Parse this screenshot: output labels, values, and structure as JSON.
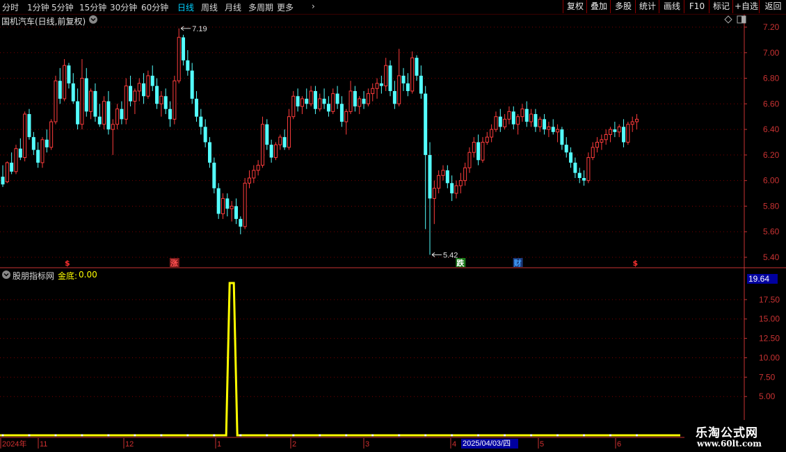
{
  "toolbar": {
    "periods": [
      "分时",
      "1分钟",
      "5分钟",
      "15分钟",
      "30分钟",
      "60分钟",
      "日线",
      "周线",
      "月线",
      "多周期",
      "更多"
    ],
    "active_period": "日线",
    "more_arrow": "›",
    "buttons": [
      "复权",
      "叠加",
      "多股",
      "统计",
      "画线",
      "F10",
      "标记",
      "+自选",
      "返回"
    ]
  },
  "main_panel": {
    "title": "国机汽车(日线,前复权)",
    "high_label": "7.19",
    "low_label": "5.42",
    "markers": [
      {
        "text": "$",
        "color": "#ff3030"
      },
      {
        "text": "涨",
        "color": "#ff5050"
      },
      {
        "text": "跌",
        "color": "#ffffff"
      },
      {
        "text": "财",
        "color": "#40a0ff"
      },
      {
        "text": "$",
        "color": "#ff3030"
      }
    ]
  },
  "sub_panel": {
    "indicator_name": "股朋指标网",
    "series_label": "金底:",
    "series_value": "0.00",
    "current_value_box": "19.64"
  },
  "x_axis": {
    "labels": [
      "2024年",
      "11",
      "12",
      "1",
      "2",
      "3",
      "4",
      "5",
      "6"
    ],
    "cursor_date": "2025/04/03/四"
  },
  "watermark": {
    "line1": "乐淘公式网",
    "line2": "www.60lt.com"
  },
  "colors": {
    "up": "#ff3c3c",
    "down": "#54ffff",
    "indicator": "#ffff00",
    "grid": "#7a0000",
    "axis": "#c83232"
  },
  "chart_data": [
    {
      "type": "candlestick",
      "title": "国机汽车(日线,前复权)",
      "y_ticks": [
        7.2,
        7.0,
        6.8,
        6.6,
        6.4,
        6.2,
        6.0,
        5.8,
        5.6,
        5.4
      ],
      "ylim": [
        5.37,
        7.26
      ],
      "annotations": [
        {
          "label": "7.19",
          "value": 7.19
        },
        {
          "label": "5.42",
          "value": 5.42
        }
      ],
      "ohlc": [
        [
          6.03,
          6.12,
          5.95,
          5.97
        ],
        [
          5.99,
          6.15,
          5.98,
          6.14
        ],
        [
          6.14,
          6.22,
          6.05,
          6.07
        ],
        [
          6.07,
          6.28,
          6.05,
          6.25
        ],
        [
          6.25,
          6.33,
          6.16,
          6.18
        ],
        [
          6.18,
          6.54,
          6.15,
          6.52
        ],
        [
          6.52,
          6.56,
          6.32,
          6.34
        ],
        [
          6.34,
          6.38,
          6.2,
          6.24
        ],
        [
          6.24,
          6.3,
          6.1,
          6.14
        ],
        [
          6.14,
          6.34,
          6.1,
          6.32
        ],
        [
          6.32,
          6.4,
          6.22,
          6.26
        ],
        [
          6.26,
          6.48,
          6.24,
          6.46
        ],
        [
          6.46,
          6.82,
          6.44,
          6.78
        ],
        [
          6.78,
          6.88,
          6.6,
          6.64
        ],
        [
          6.64,
          6.95,
          6.62,
          6.9
        ],
        [
          6.9,
          6.92,
          6.72,
          6.76
        ],
        [
          6.76,
          6.84,
          6.6,
          6.62
        ],
        [
          6.62,
          6.72,
          6.4,
          6.44
        ],
        [
          6.44,
          6.95,
          6.4,
          6.8
        ],
        [
          6.8,
          6.88,
          6.5,
          6.54
        ],
        [
          6.54,
          6.72,
          6.48,
          6.7
        ],
        [
          6.7,
          6.76,
          6.46,
          6.5
        ],
        [
          6.5,
          6.6,
          6.42,
          6.44
        ],
        [
          6.44,
          6.66,
          6.4,
          6.62
        ],
        [
          6.62,
          6.7,
          6.36,
          6.4
        ],
        [
          6.4,
          6.48,
          6.2,
          6.44
        ],
        [
          6.44,
          6.6,
          6.4,
          6.56
        ],
        [
          6.56,
          6.62,
          6.44,
          6.48
        ],
        [
          6.48,
          6.8,
          6.44,
          6.74
        ],
        [
          6.74,
          6.82,
          6.58,
          6.62
        ],
        [
          6.62,
          6.72,
          6.52,
          6.7
        ],
        [
          6.7,
          6.8,
          6.62,
          6.76
        ],
        [
          6.76,
          6.84,
          6.6,
          6.66
        ],
        [
          6.66,
          6.86,
          6.64,
          6.82
        ],
        [
          6.82,
          6.9,
          6.7,
          6.74
        ],
        [
          6.74,
          6.8,
          6.56,
          6.6
        ],
        [
          6.6,
          6.7,
          6.5,
          6.66
        ],
        [
          6.66,
          6.72,
          6.52,
          6.56
        ],
        [
          6.56,
          6.62,
          6.42,
          6.48
        ],
        [
          6.48,
          6.82,
          6.44,
          6.78
        ],
        [
          6.78,
          7.19,
          6.76,
          7.12
        ],
        [
          7.12,
          7.14,
          6.9,
          6.94
        ],
        [
          6.94,
          7.02,
          6.82,
          6.86
        ],
        [
          6.86,
          6.92,
          6.6,
          6.64
        ],
        [
          6.64,
          6.7,
          6.46,
          6.5
        ],
        [
          6.5,
          6.56,
          6.36,
          6.42
        ],
        [
          6.42,
          6.48,
          6.26,
          6.3
        ],
        [
          6.3,
          6.34,
          6.1,
          6.14
        ],
        [
          6.14,
          6.18,
          5.9,
          5.94
        ],
        [
          5.94,
          5.98,
          5.7,
          5.74
        ],
        [
          5.74,
          5.9,
          5.7,
          5.86
        ],
        [
          5.86,
          5.9,
          5.72,
          5.78
        ],
        [
          5.78,
          5.84,
          5.68,
          5.8
        ],
        [
          5.8,
          5.86,
          5.66,
          5.7
        ],
        [
          5.7,
          5.72,
          5.58,
          5.64
        ],
        [
          5.64,
          6.02,
          5.62,
          5.98
        ],
        [
          5.98,
          6.08,
          5.94,
          6.02
        ],
        [
          6.02,
          6.12,
          5.98,
          6.08
        ],
        [
          6.08,
          6.16,
          6.04,
          6.12
        ],
        [
          6.12,
          6.5,
          6.1,
          6.44
        ],
        [
          6.44,
          6.48,
          6.24,
          6.28
        ],
        [
          6.28,
          6.32,
          6.14,
          6.18
        ],
        [
          6.18,
          6.3,
          6.16,
          6.28
        ],
        [
          6.28,
          6.36,
          6.24,
          6.34
        ],
        [
          6.34,
          6.4,
          6.24,
          6.26
        ],
        [
          6.26,
          6.56,
          6.24,
          6.5
        ],
        [
          6.5,
          6.7,
          6.48,
          6.66
        ],
        [
          6.66,
          6.72,
          6.54,
          6.58
        ],
        [
          6.58,
          6.66,
          6.52,
          6.64
        ],
        [
          6.64,
          6.72,
          6.56,
          6.6
        ],
        [
          6.6,
          6.74,
          6.58,
          6.7
        ],
        [
          6.7,
          6.74,
          6.52,
          6.56
        ],
        [
          6.56,
          6.68,
          6.54,
          6.64
        ],
        [
          6.64,
          6.72,
          6.56,
          6.6
        ],
        [
          6.6,
          6.66,
          6.5,
          6.54
        ],
        [
          6.54,
          6.72,
          6.52,
          6.68
        ],
        [
          6.68,
          6.74,
          6.56,
          6.6
        ],
        [
          6.6,
          6.66,
          6.42,
          6.46
        ],
        [
          6.46,
          6.56,
          6.36,
          6.54
        ],
        [
          6.54,
          6.78,
          6.52,
          6.7
        ],
        [
          6.7,
          6.74,
          6.54,
          6.58
        ],
        [
          6.58,
          6.66,
          6.52,
          6.64
        ],
        [
          6.64,
          6.7,
          6.56,
          6.6
        ],
        [
          6.6,
          6.72,
          6.58,
          6.68
        ],
        [
          6.68,
          6.76,
          6.62,
          6.72
        ],
        [
          6.72,
          6.8,
          6.64,
          6.76
        ],
        [
          6.76,
          6.82,
          6.68,
          6.74
        ],
        [
          6.74,
          6.96,
          6.7,
          6.9
        ],
        [
          6.9,
          6.94,
          6.66,
          6.7
        ],
        [
          6.7,
          6.78,
          6.56,
          6.6
        ],
        [
          6.6,
          7.03,
          6.58,
          6.82
        ],
        [
          6.82,
          6.88,
          6.7,
          6.76
        ],
        [
          6.76,
          6.84,
          6.66,
          6.7
        ],
        [
          6.7,
          7.01,
          6.68,
          6.96
        ],
        [
          6.96,
          6.98,
          6.78,
          6.82
        ],
        [
          6.82,
          6.9,
          6.64,
          6.68
        ],
        [
          6.68,
          6.74,
          5.62,
          6.2
        ],
        [
          6.2,
          6.3,
          5.42,
          5.86
        ],
        [
          5.86,
          6.0,
          5.66,
          5.94
        ],
        [
          5.94,
          6.08,
          5.9,
          6.04
        ],
        [
          6.04,
          6.12,
          6.0,
          6.08
        ],
        [
          6.08,
          6.12,
          5.94,
          5.98
        ],
        [
          5.98,
          6.04,
          5.84,
          5.9
        ],
        [
          5.9,
          6.0,
          5.86,
          5.96
        ],
        [
          5.96,
          6.06,
          5.9,
          6.0
        ],
        [
          6.0,
          6.14,
          5.96,
          6.1
        ],
        [
          6.1,
          6.26,
          6.06,
          6.22
        ],
        [
          6.22,
          6.34,
          6.18,
          6.3
        ],
        [
          6.3,
          6.36,
          6.12,
          6.16
        ],
        [
          6.16,
          6.34,
          6.14,
          6.3
        ],
        [
          6.3,
          6.38,
          6.28,
          6.34
        ],
        [
          6.34,
          6.44,
          6.3,
          6.4
        ],
        [
          6.4,
          6.54,
          6.38,
          6.5
        ],
        [
          6.5,
          6.56,
          6.38,
          6.42
        ],
        [
          6.42,
          6.52,
          6.4,
          6.48
        ],
        [
          6.48,
          6.58,
          6.44,
          6.54
        ],
        [
          6.54,
          6.58,
          6.4,
          6.44
        ],
        [
          6.44,
          6.52,
          6.36,
          6.5
        ],
        [
          6.5,
          6.6,
          6.46,
          6.56
        ],
        [
          6.56,
          6.62,
          6.42,
          6.46
        ],
        [
          6.46,
          6.56,
          6.42,
          6.52
        ],
        [
          6.52,
          6.56,
          6.38,
          6.42
        ],
        [
          6.42,
          6.5,
          6.38,
          6.48
        ],
        [
          6.48,
          6.52,
          6.36,
          6.4
        ],
        [
          6.4,
          6.46,
          6.34,
          6.42
        ],
        [
          6.42,
          6.48,
          6.36,
          6.38
        ],
        [
          6.38,
          6.44,
          6.3,
          6.4
        ],
        [
          6.4,
          6.42,
          6.24,
          6.28
        ],
        [
          6.28,
          6.34,
          6.18,
          6.22
        ],
        [
          6.22,
          6.26,
          6.1,
          6.14
        ],
        [
          6.14,
          6.18,
          6.02,
          6.06
        ],
        [
          6.06,
          6.1,
          5.98,
          6.02
        ],
        [
          6.02,
          6.08,
          5.96,
          6.0
        ],
        [
          6.0,
          6.22,
          5.98,
          6.18
        ],
        [
          6.18,
          6.3,
          6.16,
          6.26
        ],
        [
          6.26,
          6.34,
          6.22,
          6.3
        ],
        [
          6.3,
          6.36,
          6.24,
          6.32
        ],
        [
          6.32,
          6.4,
          6.28,
          6.36
        ],
        [
          6.36,
          6.42,
          6.3,
          6.4
        ],
        [
          6.4,
          6.46,
          6.34,
          6.38
        ],
        [
          6.38,
          6.44,
          6.34,
          6.42
        ],
        [
          6.42,
          6.48,
          6.26,
          6.3
        ],
        [
          6.3,
          6.46,
          6.28,
          6.44
        ],
        [
          6.44,
          6.5,
          6.38,
          6.46
        ],
        [
          6.46,
          6.52,
          6.4,
          6.48
        ]
      ]
    },
    {
      "type": "line",
      "title": "股朋指标网",
      "series": [
        {
          "name": "金底",
          "peak_index": 52,
          "peak_value": 19.64,
          "base_value": 0.0
        }
      ],
      "y_ticks": [
        17.5,
        15.0,
        12.5,
        10.0,
        7.5,
        5.0
      ],
      "ylim": [
        0,
        20.5
      ]
    }
  ]
}
